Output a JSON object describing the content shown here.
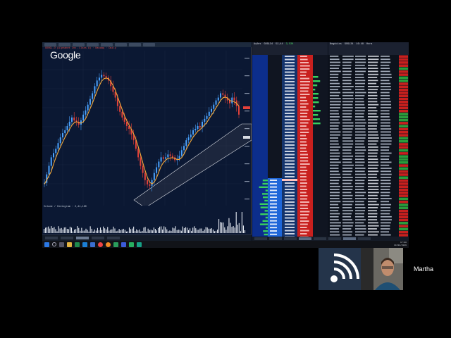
{
  "chart": {
    "title_line": "GOOGL.O (Alphabet Inc. Class A) · Nasdaq · Daily",
    "logo_text": "Google",
    "volume_header": "Volume / Histogram · 2,41,180",
    "trend": [
      0.12,
      0.18,
      0.24,
      0.3,
      0.33,
      0.36,
      0.4,
      0.44,
      0.47,
      0.49,
      0.52,
      0.55,
      0.58,
      0.56,
      0.55,
      0.53,
      0.56,
      0.6,
      0.63,
      0.67,
      0.71,
      0.75,
      0.8,
      0.84,
      0.86,
      0.88,
      0.87,
      0.86,
      0.84,
      0.8,
      0.76,
      0.72,
      0.66,
      0.62,
      0.58,
      0.55,
      0.52,
      0.5,
      0.46,
      0.42,
      0.36,
      0.3,
      0.24,
      0.19,
      0.14,
      0.11,
      0.1,
      0.14,
      0.19,
      0.23,
      0.27,
      0.3,
      0.29,
      0.3,
      0.32,
      0.31,
      0.3,
      0.28,
      0.29,
      0.31,
      0.35,
      0.38,
      0.42,
      0.44,
      0.46,
      0.49,
      0.5,
      0.52,
      0.51,
      0.55,
      0.57,
      0.59,
      0.62,
      0.64,
      0.67,
      0.7,
      0.72,
      0.75,
      0.74,
      0.72,
      0.7,
      0.68,
      0.72,
      0.7,
      0.66,
      0.6
    ]
  },
  "order_book": {
    "header_labels": [
      "Ações",
      "GOGL34",
      "52,44",
      "3,53%"
    ]
  },
  "times_sales": {
    "header_labels": [
      "Negócios",
      "GOGL34",
      "16:48",
      "Hora"
    ]
  },
  "taskbar": {
    "clock_time": "17:00",
    "clock_date": "14/02/2019"
  },
  "webcam": {
    "participant_name": "Martha",
    "logo_icon": "broadcast-signal-icon"
  },
  "colors": {
    "screen_bg": "#0b1833",
    "buy_blue": "#1e66d8",
    "sell_red": "#c8201e",
    "trend_orange": "#f3a83a",
    "candle_up": "#4aa3ff",
    "candle_down": "#e4413a",
    "volume_white": "#e8edf5",
    "channel_line": "#d8dbe2"
  }
}
